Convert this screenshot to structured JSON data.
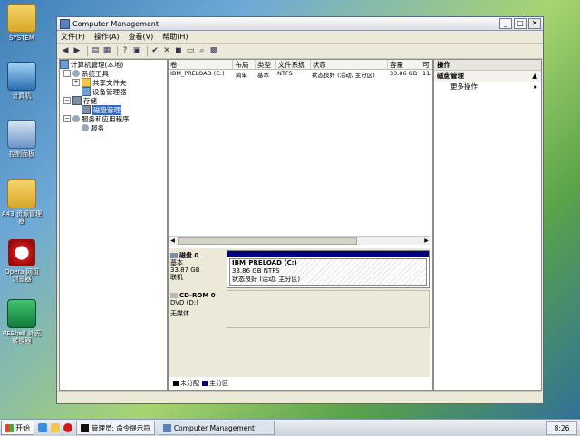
{
  "desktop": {
    "icons": [
      {
        "label": "SYSTEM"
      },
      {
        "label": "计算机"
      },
      {
        "label": "控制面板"
      },
      {
        "label": "A43 资源管理器"
      },
      {
        "label": "Opera 网页浏览器"
      },
      {
        "label": "PEShell 外壳转换器"
      }
    ]
  },
  "window": {
    "title": "Computer Management",
    "menu": [
      "文件(F)",
      "操作(A)",
      "查看(V)",
      "帮助(H)"
    ]
  },
  "tree": {
    "root": "计算机管理(本地)",
    "items": [
      "系统工具",
      "共享文件夹",
      "设备管理器",
      "存储",
      "磁盘管理",
      "服务和应用程序",
      "服务"
    ]
  },
  "volumes": {
    "columns": [
      "卷",
      "布局",
      "类型",
      "文件系统",
      "状态",
      "容量",
      "可"
    ],
    "rows": [
      {
        "name": "IBM_PRELOAD (C:)",
        "layout": "简单",
        "type": "基本",
        "fs": "NTFS",
        "status": "状态良好 (活动, 主分区)",
        "capacity": "33.86 GB",
        "free": "11."
      }
    ]
  },
  "disks": {
    "disk0": {
      "name": "磁盘 0",
      "type": "基本",
      "size": "33.87 GB",
      "state": "联机",
      "partition": {
        "name": "IBM_PRELOAD (C:)",
        "size": "33.86 GB NTFS",
        "status": "状态良好 (活动, 主分区)"
      }
    },
    "cdrom0": {
      "name": "CD-ROM 0",
      "drive": "DVD (D:)",
      "media": "无媒体"
    }
  },
  "legend": {
    "unallocated": "未分配",
    "primary": "主分区"
  },
  "actions": {
    "header": "操作",
    "section": "磁盘管理",
    "more": "更多操作"
  },
  "taskbar": {
    "start": "开始",
    "tasks": [
      "管理员: 命令提示符",
      "Computer Management"
    ],
    "clock": "8:26"
  },
  "colors": {
    "primary_partition": "#000080",
    "unallocated": "#000000"
  }
}
